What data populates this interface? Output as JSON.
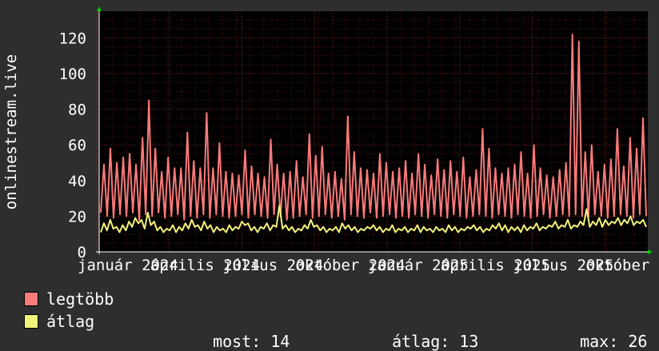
{
  "chart_data": {
    "type": "line",
    "ylabel": "onlinestream.live",
    "ylim": [
      0,
      135
    ],
    "yticks": [
      0,
      20,
      40,
      60,
      80,
      100,
      120
    ],
    "xticks": [
      "január",
      "április",
      "július",
      "október",
      "január",
      "április",
      "július",
      "október"
    ],
    "xtick_years": [
      "2024",
      "2024",
      "2024",
      "2024",
      "2025",
      "2025",
      "2025",
      "2025"
    ],
    "background": "#000000",
    "grid": true,
    "colors": {
      "max": "#f87a7a",
      "avg": "#f2f27a",
      "grid": "#8a2020",
      "axis": "#ffffff",
      "arrow": "#00cc00"
    },
    "series": [
      {
        "name": "legtöbb",
        "values": [
          22,
          49,
          20,
          58,
          19,
          50,
          21,
          53,
          20,
          55,
          22,
          49,
          18,
          64,
          21,
          85,
          20,
          58,
          22,
          45,
          19,
          53,
          20,
          47,
          21,
          47,
          18,
          67,
          20,
          51,
          19,
          47,
          21,
          78,
          19,
          47,
          21,
          61,
          20,
          45,
          19,
          44,
          20,
          43,
          21,
          57,
          19,
          48,
          21,
          44,
          20,
          42,
          19,
          63,
          21,
          49,
          20,
          44,
          18,
          45,
          19,
          51,
          20,
          42,
          21,
          66,
          19,
          54,
          20,
          59,
          21,
          44,
          19,
          45,
          20,
          41,
          18,
          76,
          21,
          56,
          20,
          47,
          19,
          46,
          22,
          44,
          19,
          55,
          20,
          50,
          21,
          45,
          19,
          47,
          20,
          51,
          19,
          44,
          21,
          55,
          20,
          49,
          19,
          43,
          21,
          52,
          20,
          46,
          19,
          51,
          21,
          45,
          20,
          53,
          19,
          42,
          20,
          46,
          21,
          69,
          20,
          58,
          19,
          47,
          21,
          44,
          20,
          47,
          19,
          49,
          21,
          56,
          20,
          44,
          19,
          60,
          20,
          47,
          21,
          43,
          19,
          42,
          20,
          46,
          21,
          50,
          20,
          122,
          21,
          118,
          20,
          56,
          19,
          60,
          21,
          45,
          20,
          49,
          19,
          52,
          20,
          69,
          21,
          48,
          20,
          64,
          19,
          58,
          21,
          75,
          20
        ]
      },
      {
        "name": "átlag",
        "values": [
          11,
          16,
          12,
          18,
          13,
          14,
          11,
          15,
          12,
          17,
          14,
          19,
          16,
          18,
          13,
          22,
          15,
          17,
          12,
          14,
          11,
          13,
          12,
          15,
          11,
          14,
          12,
          16,
          13,
          18,
          14,
          15,
          12,
          17,
          13,
          15,
          11,
          14,
          12,
          13,
          11,
          15,
          12,
          14,
          13,
          17,
          15,
          16,
          12,
          14,
          11,
          14,
          13,
          16,
          12,
          15,
          14,
          26,
          13,
          15,
          12,
          14,
          11,
          13,
          12,
          15,
          13,
          18,
          14,
          15,
          12,
          14,
          11,
          13,
          12,
          14,
          11,
          16,
          13,
          15,
          12,
          14,
          11,
          13,
          12,
          14,
          13,
          15,
          12,
          14,
          11,
          13,
          12,
          15,
          11,
          13,
          12,
          14,
          11,
          13,
          12,
          15,
          11,
          14,
          12,
          13,
          11,
          14,
          12,
          13,
          11,
          15,
          12,
          14,
          11,
          13,
          12,
          14,
          13,
          15,
          12,
          14,
          11,
          13,
          12,
          15,
          13,
          16,
          12,
          15,
          11,
          14,
          12,
          14,
          11,
          15,
          12,
          14,
          13,
          16,
          12,
          14,
          13,
          15,
          14,
          17,
          13,
          15,
          14,
          18,
          13,
          15,
          14,
          17,
          15,
          24,
          14,
          17,
          15,
          19,
          14,
          18,
          15,
          17,
          16,
          19,
          15,
          18,
          16,
          20,
          15,
          17,
          16,
          18,
          14
        ]
      }
    ]
  },
  "legend": {
    "max_label": "legtöbb",
    "avg_label": "átlag"
  },
  "stats": {
    "now_label": "most:",
    "now_value": "14",
    "avg_label": "átlag:",
    "avg_value": "13",
    "max_label": "max:",
    "max_value": "26"
  }
}
